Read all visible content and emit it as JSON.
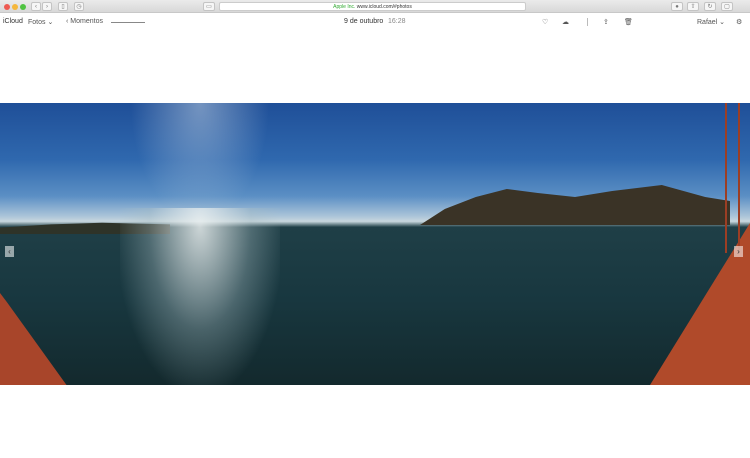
{
  "browser": {
    "url_company": "Apple Inc.",
    "url": "www.icloud.com/#photos"
  },
  "app": {
    "brand": "iCloud",
    "section": "Fotos",
    "back_label": "Momentos",
    "date": "9 de outubro",
    "time": "16:28",
    "user": "Rafael"
  },
  "icons": [
    "heart-icon",
    "cloud-download-icon",
    "share-icon",
    "trash-icon",
    "help-icon",
    "chevron-left-icon",
    "chevron-right-icon"
  ],
  "colors": {
    "url_lock": "#33aa33",
    "toolbar_text": "#555555"
  }
}
